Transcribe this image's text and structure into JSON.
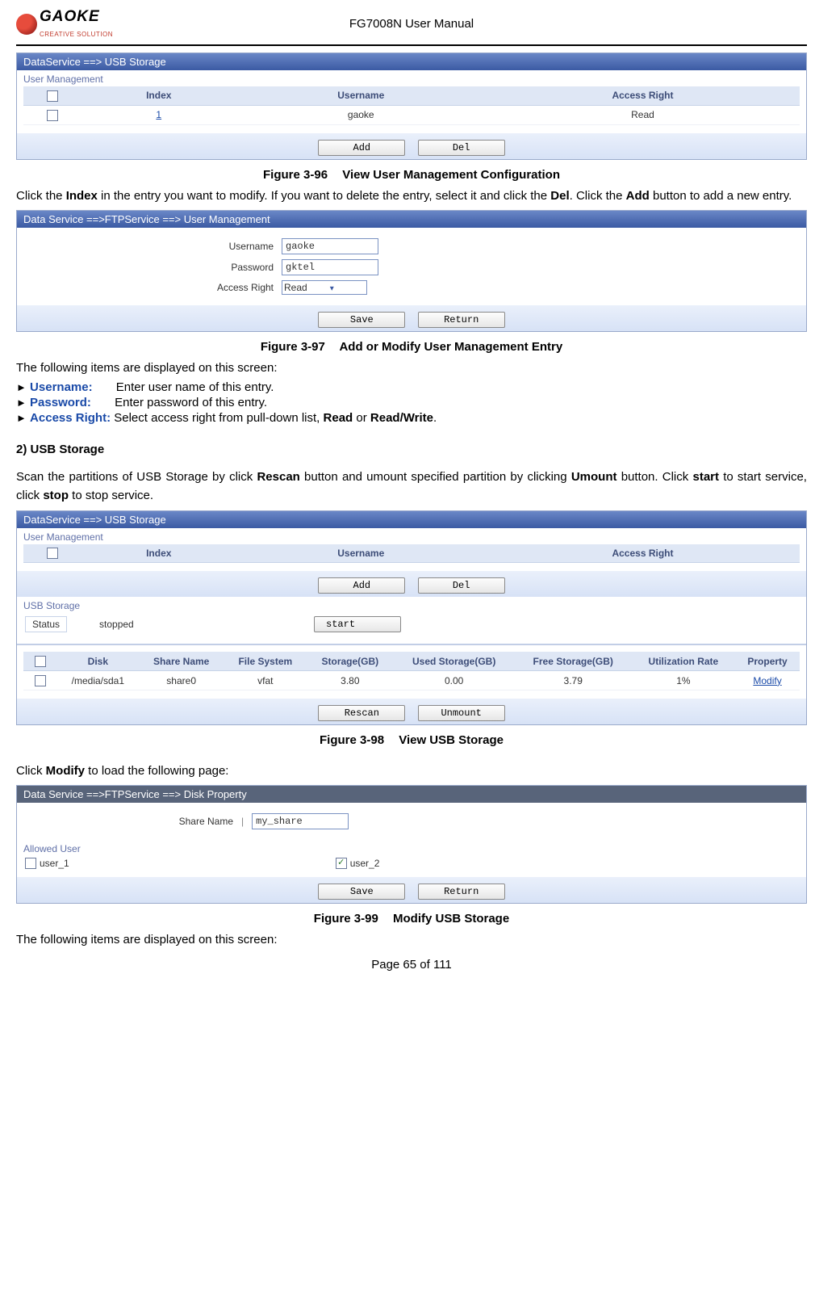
{
  "header": {
    "brand_main": "GAOKE",
    "brand_sub": "CREATIVE SOLUTION",
    "doc_title": "FG7008N User Manual"
  },
  "fig96": {
    "caption_no": "Figure 3-96",
    "caption_title": "View User Management Configuration",
    "titlebar": "DataService ==> USB Storage",
    "fieldset_label": "User Management",
    "columns": {
      "c0": "",
      "c1": "Index",
      "c2": "Username",
      "c3": "Access Right"
    },
    "row": {
      "index": "1",
      "username": "gaoke",
      "access": "Read"
    },
    "btn_add": "Add",
    "btn_del": "Del"
  },
  "text_after_96_a": "Click the ",
  "text_after_96_b": "Index",
  "text_after_96_c": " in the entry you want to modify. If you want to delete the entry, select it and click the ",
  "text_after_96_d": "Del",
  "text_after_96_e": ". Click the ",
  "text_after_96_f": "Add",
  "text_after_96_g": " button to add a new entry.",
  "fig97": {
    "caption_no": "Figure 3-97",
    "caption_title": "Add or Modify User Management Entry",
    "titlebar": "Data Service ==>FTPService ==> User Management",
    "lbl_username": "Username",
    "val_username": "gaoke",
    "lbl_password": "Password",
    "val_password": "gktel",
    "lbl_access": "Access Right",
    "val_access": "Read",
    "btn_save": "Save",
    "btn_return": "Return"
  },
  "displayed_intro": "The following items are displayed on this screen:",
  "defs": {
    "arrow": "►",
    "username_key": "Username:",
    "username_txt": "Enter user name of this entry.",
    "password_key": "Password:",
    "password_txt": "Enter password of this entry.",
    "access_key": "Access Right:",
    "access_txt_a": "Select access right from pull-down list, ",
    "access_txt_b": "Read",
    "access_txt_c": " or ",
    "access_txt_d": "Read/Write",
    "access_txt_e": "."
  },
  "section2_head": "2) USB Storage",
  "section2_text_a": "Scan the partitions of USB Storage by click ",
  "section2_text_b": "Rescan",
  "section2_text_c": " button and umount specified partition by clicking ",
  "section2_text_d": "Umount",
  "section2_text_e": " button. Click ",
  "section2_text_f": "start",
  "section2_text_g": " to start service, click ",
  "section2_text_h": "stop",
  "section2_text_i": " to stop service.",
  "fig98": {
    "caption_no": "Figure 3-98",
    "caption_title": "View USB Storage",
    "titlebar": "DataService ==> USB Storage",
    "um_label": "User Management",
    "um_columns": {
      "c0": "",
      "c1": "Index",
      "c2": "Username",
      "c3": "Access Right"
    },
    "btn_add": "Add",
    "btn_del": "Del",
    "usb_label": "USB Storage",
    "status_label": "Status",
    "status_value": "stopped",
    "btn_start": "start",
    "disk_columns": {
      "c0": "",
      "c1": "Disk",
      "c2": "Share Name",
      "c3": "File System",
      "c4": "Storage(GB)",
      "c5": "Used Storage(GB)",
      "c6": "Free Storage(GB)",
      "c7": "Utilization Rate",
      "c8": "Property"
    },
    "disk_row": {
      "disk": "/media/sda1",
      "share": "share0",
      "fs": "vfat",
      "storage": "3.80",
      "used": "0.00",
      "free": "3.79",
      "util": "1%",
      "prop": "Modify"
    },
    "btn_rescan": "Rescan",
    "btn_unmount": "Unmount"
  },
  "modify_intro_a": "Click ",
  "modify_intro_b": "Modify",
  "modify_intro_c": " to load the following page:",
  "fig99": {
    "caption_no": "Figure 3-99",
    "caption_title": "Modify USB Storage",
    "titlebar": "Data Service ==>FTPService ==> Disk Property",
    "lbl_share": "Share Name",
    "val_share": "my_share",
    "allowed_label": "Allowed User",
    "user1": "user_1",
    "user2": "user_2",
    "btn_save": "Save",
    "btn_return": "Return"
  },
  "footer_text": "The following items are displayed on this screen:",
  "page_footer": "Page 65 of 111"
}
